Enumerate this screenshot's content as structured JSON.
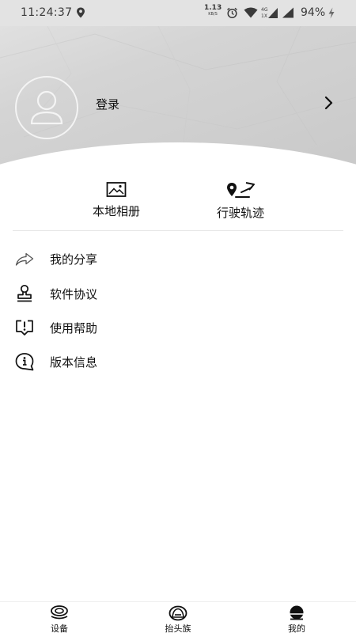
{
  "status_bar": {
    "time": "11:24:37",
    "net_speed_value": "1.13",
    "net_speed_unit": "KB/S",
    "battery": "94%",
    "icons": [
      "location-icon",
      "alarm-icon",
      "wifi-icon",
      "signal-4g-icon",
      "signal-icon",
      "charging-icon"
    ]
  },
  "header": {
    "login_label": "登录",
    "avatar_icon": "user-avatar-icon",
    "chevron_icon": "chevron-right-icon"
  },
  "quick_actions": [
    {
      "label": "本地相册",
      "icon": "image-icon"
    },
    {
      "label": "行驶轨迹",
      "icon": "route-icon"
    }
  ],
  "menu": [
    {
      "label": "我的分享",
      "icon": "share-icon"
    },
    {
      "label": "软件协议",
      "icon": "stamp-icon"
    },
    {
      "label": "使用帮助",
      "icon": "help-icon"
    },
    {
      "label": "版本信息",
      "icon": "info-icon"
    }
  ],
  "bottom_nav": [
    {
      "label": "设备",
      "icon": "device-icon"
    },
    {
      "label": "抬头族",
      "icon": "heads-up-icon"
    },
    {
      "label": "我的",
      "icon": "mine-icon",
      "active": true
    }
  ],
  "colors": {
    "text": "#111111",
    "header_bg": "#d0d0d0",
    "divider": "#e6e6e6"
  }
}
